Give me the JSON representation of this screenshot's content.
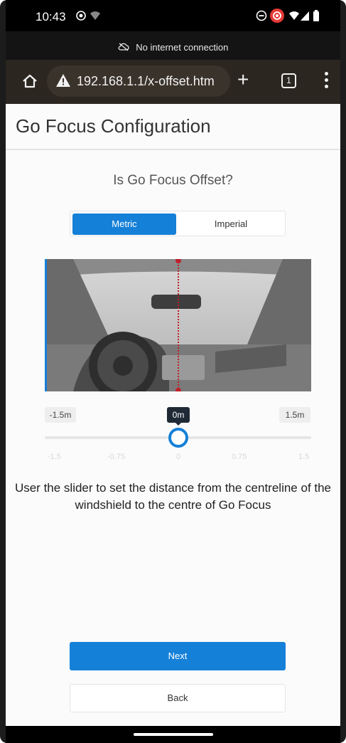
{
  "status_bar": {
    "time": "10:43",
    "left_icons": [
      "record-icon",
      "wifi-icon"
    ],
    "right_icons": [
      "do-not-disturb-icon",
      "recording-badge-icon",
      "wifi-signal-icon",
      "cell-signal-icon",
      "battery-icon"
    ]
  },
  "offline_banner": {
    "icon": "cloud-off-icon",
    "text": "No internet connection"
  },
  "browser": {
    "url": "192.168.1.1/x-offset.htm",
    "tab_count": "1"
  },
  "page": {
    "title": "Go Focus Configuration",
    "question": "Is Go Focus Offset?",
    "units": {
      "options": [
        "Metric",
        "Imperial"
      ],
      "selected": "Metric"
    },
    "slider": {
      "min_label": "-1.5m",
      "max_label": "1.5m",
      "value_label": "0m",
      "value": 0,
      "min": -1.5,
      "max": 1.5,
      "ticks": [
        "-1.5",
        "-0.75",
        "0",
        "0.75",
        "1.5"
      ]
    },
    "instruction": "User the slider to set the distance from the centreline of the windshield to the centre of Go Focus",
    "next_label": "Next",
    "back_label": "Back"
  },
  "colors": {
    "accent": "#1580d8",
    "value_badge": "#1f2a36",
    "centre_line": "#c0202a"
  }
}
